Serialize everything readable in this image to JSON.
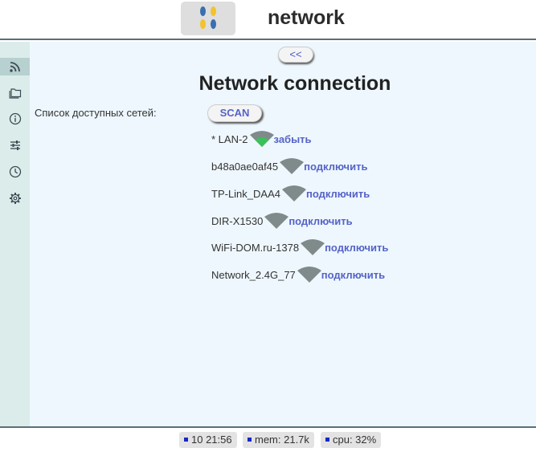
{
  "header": {
    "title": "network",
    "logo_colors": [
      "#3a6fb0",
      "#f2c32c"
    ]
  },
  "sidebar": {
    "items": [
      {
        "icon": "rss-icon",
        "active": true
      },
      {
        "icon": "folder-icon",
        "active": false
      },
      {
        "icon": "info-icon",
        "active": false
      },
      {
        "icon": "sliders-icon",
        "active": false
      },
      {
        "icon": "clock-icon",
        "active": false
      },
      {
        "icon": "gear-icon",
        "active": false
      }
    ]
  },
  "main": {
    "back_label": "<<",
    "heading": "Network connection",
    "list_label": "Список доступных сетей:",
    "scan_label": "SCAN",
    "networks": [
      {
        "name": "* LAN-2",
        "action": "забыть",
        "connected": true
      },
      {
        "name": "b48a0ae0af45",
        "action": "подключить",
        "connected": false
      },
      {
        "name": "TP-Link_DAA4",
        "action": "подключить",
        "connected": false
      },
      {
        "name": "DIR-X1530",
        "action": "подключить",
        "connected": false
      },
      {
        "name": "WiFi-DOM.ru-1378",
        "action": "подключить",
        "connected": false
      },
      {
        "name": "Network_2.4G_77",
        "action": "подключить",
        "connected": false
      }
    ]
  },
  "footer": {
    "time": "10 21:56",
    "mem": "mem: 21.7k",
    "cpu": "cpu: 32%",
    "indicator_color": "#1a25c8"
  },
  "colors": {
    "accent": "#5563c8",
    "wifi_gray": "#7f8b8b",
    "wifi_green": "#3cc05a",
    "sidebar_bg": "#dbeceb",
    "main_bg": "#eef7fd"
  }
}
